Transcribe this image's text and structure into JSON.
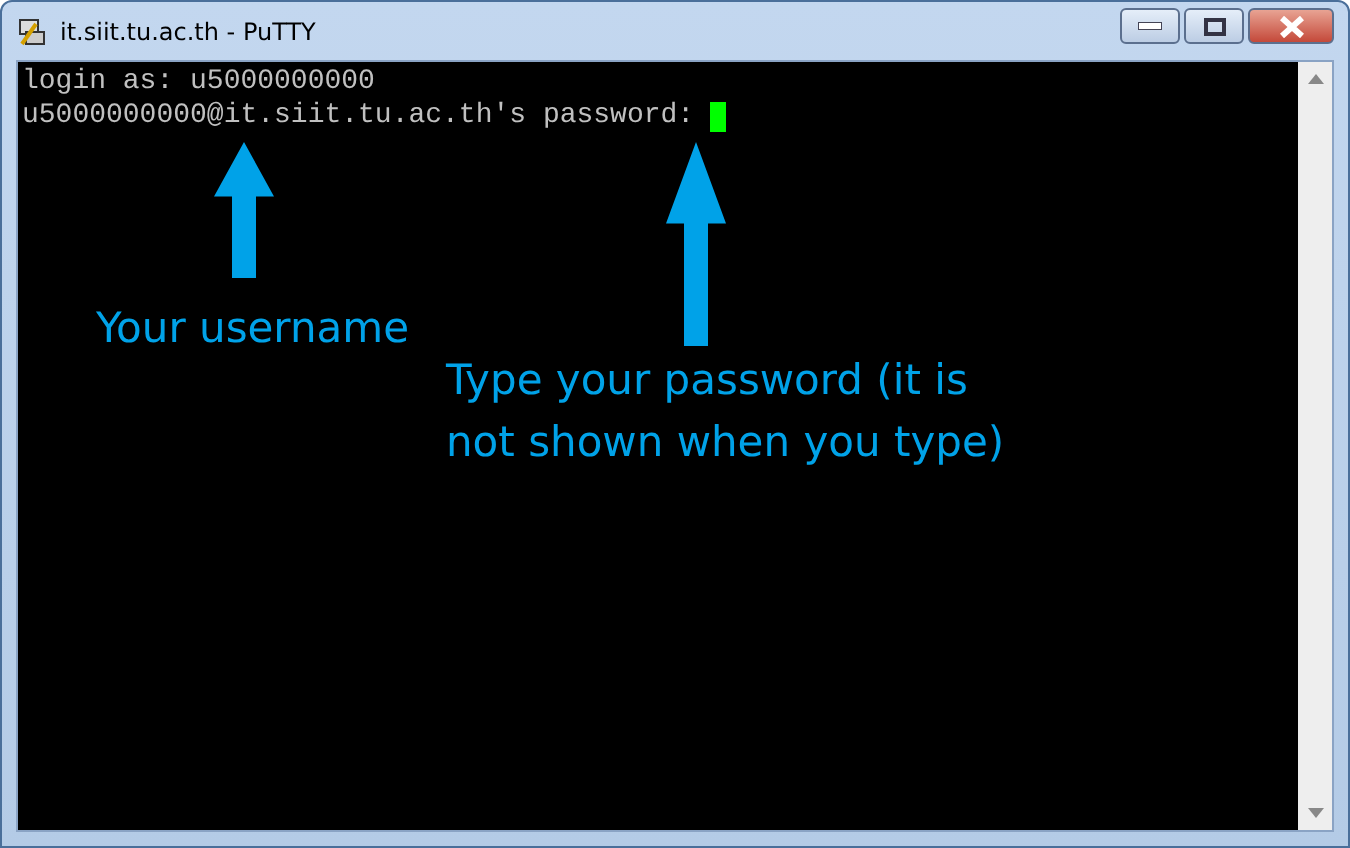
{
  "window": {
    "title": "it.siit.tu.ac.th - PuTTY"
  },
  "terminal": {
    "lines": [
      "login as: u5000000000",
      "u5000000000@it.siit.tu.ac.th's password: "
    ],
    "cursor": true
  },
  "annotations": [
    {
      "text": "Your username"
    },
    {
      "text": "Type your password (it is not shown when you type)"
    }
  ]
}
